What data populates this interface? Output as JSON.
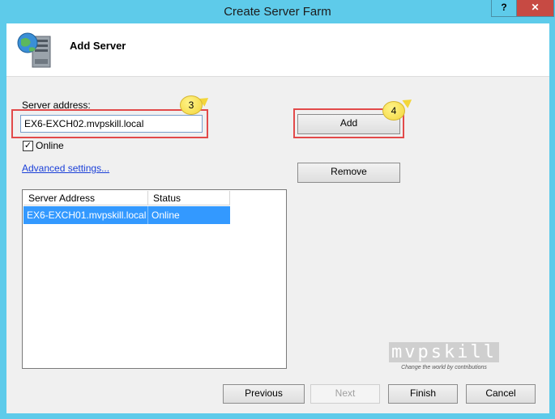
{
  "window": {
    "title": "Create Server Farm",
    "help_label": "?",
    "close_label": "✕"
  },
  "header": {
    "title": "Add Server",
    "icon": "server-globe-icon"
  },
  "form": {
    "server_address_label": "Server address:",
    "server_address_value": "EX6-EXCH02.mvpskill.local",
    "online_label": "Online",
    "online_checked": true,
    "advanced_link": "Advanced settings..."
  },
  "buttons": {
    "add": "Add",
    "remove": "Remove",
    "previous": "Previous",
    "next": "Next",
    "finish": "Finish",
    "cancel": "Cancel"
  },
  "callouts": {
    "step3": "3",
    "step4": "4"
  },
  "server_list": {
    "columns": [
      "Server Address",
      "Status"
    ],
    "rows": [
      {
        "address": "EX6-EXCH01.mvpskill.local",
        "status": "Online"
      }
    ]
  },
  "watermark": {
    "text": "mvpskill",
    "tagline": "Change the world by contributions"
  },
  "colors": {
    "title_bar": "#5ecbea",
    "close_button": "#c74a43",
    "highlight": "#e24a4a",
    "selection": "#3399ff",
    "callout": "#f3d63a"
  }
}
